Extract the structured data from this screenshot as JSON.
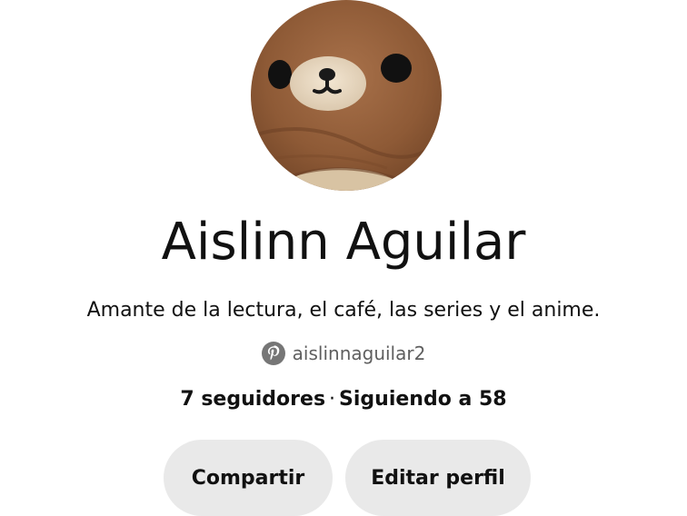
{
  "profile": {
    "name": "Aislinn Aguilar",
    "bio": "Amante de la lectura, el café, las series y el anime.",
    "handle": "aislinnaguilar2",
    "handle_icon": "pinterest-icon",
    "followers": "7 seguidores",
    "separator": "·",
    "following": "Siguiendo a 58"
  },
  "actions": {
    "share_label": "Compartir",
    "edit_label": "Editar perfil"
  },
  "colors": {
    "button_bg": "#e9e9e9",
    "text": "#111111",
    "muted": "#5f5f5f"
  }
}
